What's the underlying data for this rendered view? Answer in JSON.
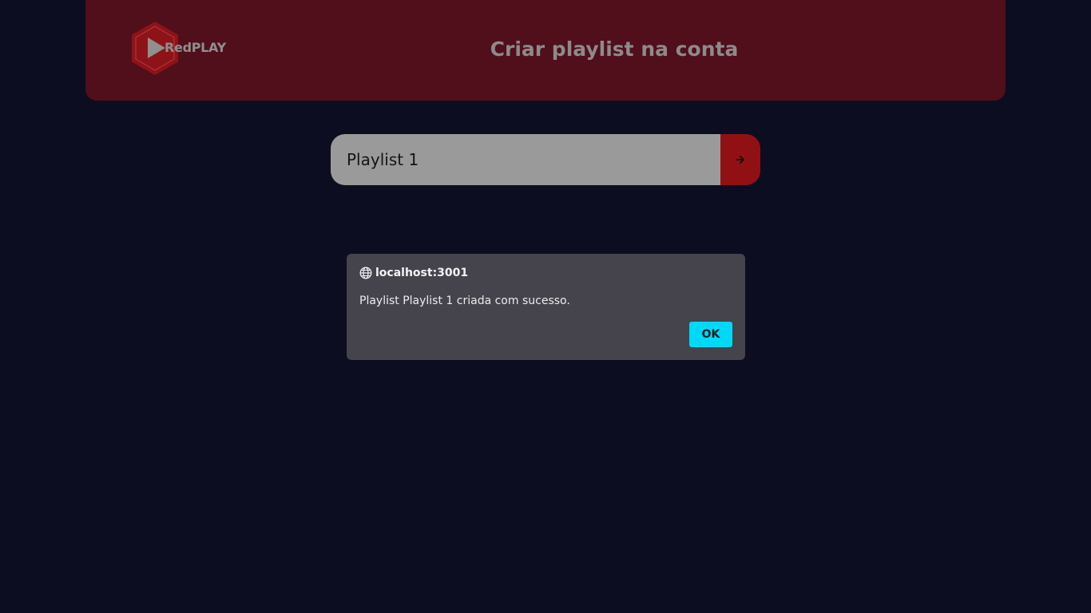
{
  "header": {
    "logo_text": "RedPLAY",
    "title": "Criar playlist na conta"
  },
  "form": {
    "input_value": "Playlist 1",
    "submit_icon": "arrow-right-icon"
  },
  "dialog": {
    "origin": "localhost:3001",
    "origin_icon": "globe-icon",
    "message": "Playlist Playlist 1 criada com sucesso.",
    "ok_label": "OK"
  },
  "colors": {
    "background": "#0c0d20",
    "header": "#510e1b",
    "accent_red": "#911013",
    "input": "#9a9a9a",
    "dialog": "#45434c",
    "ok_button": "#00d9f5"
  }
}
